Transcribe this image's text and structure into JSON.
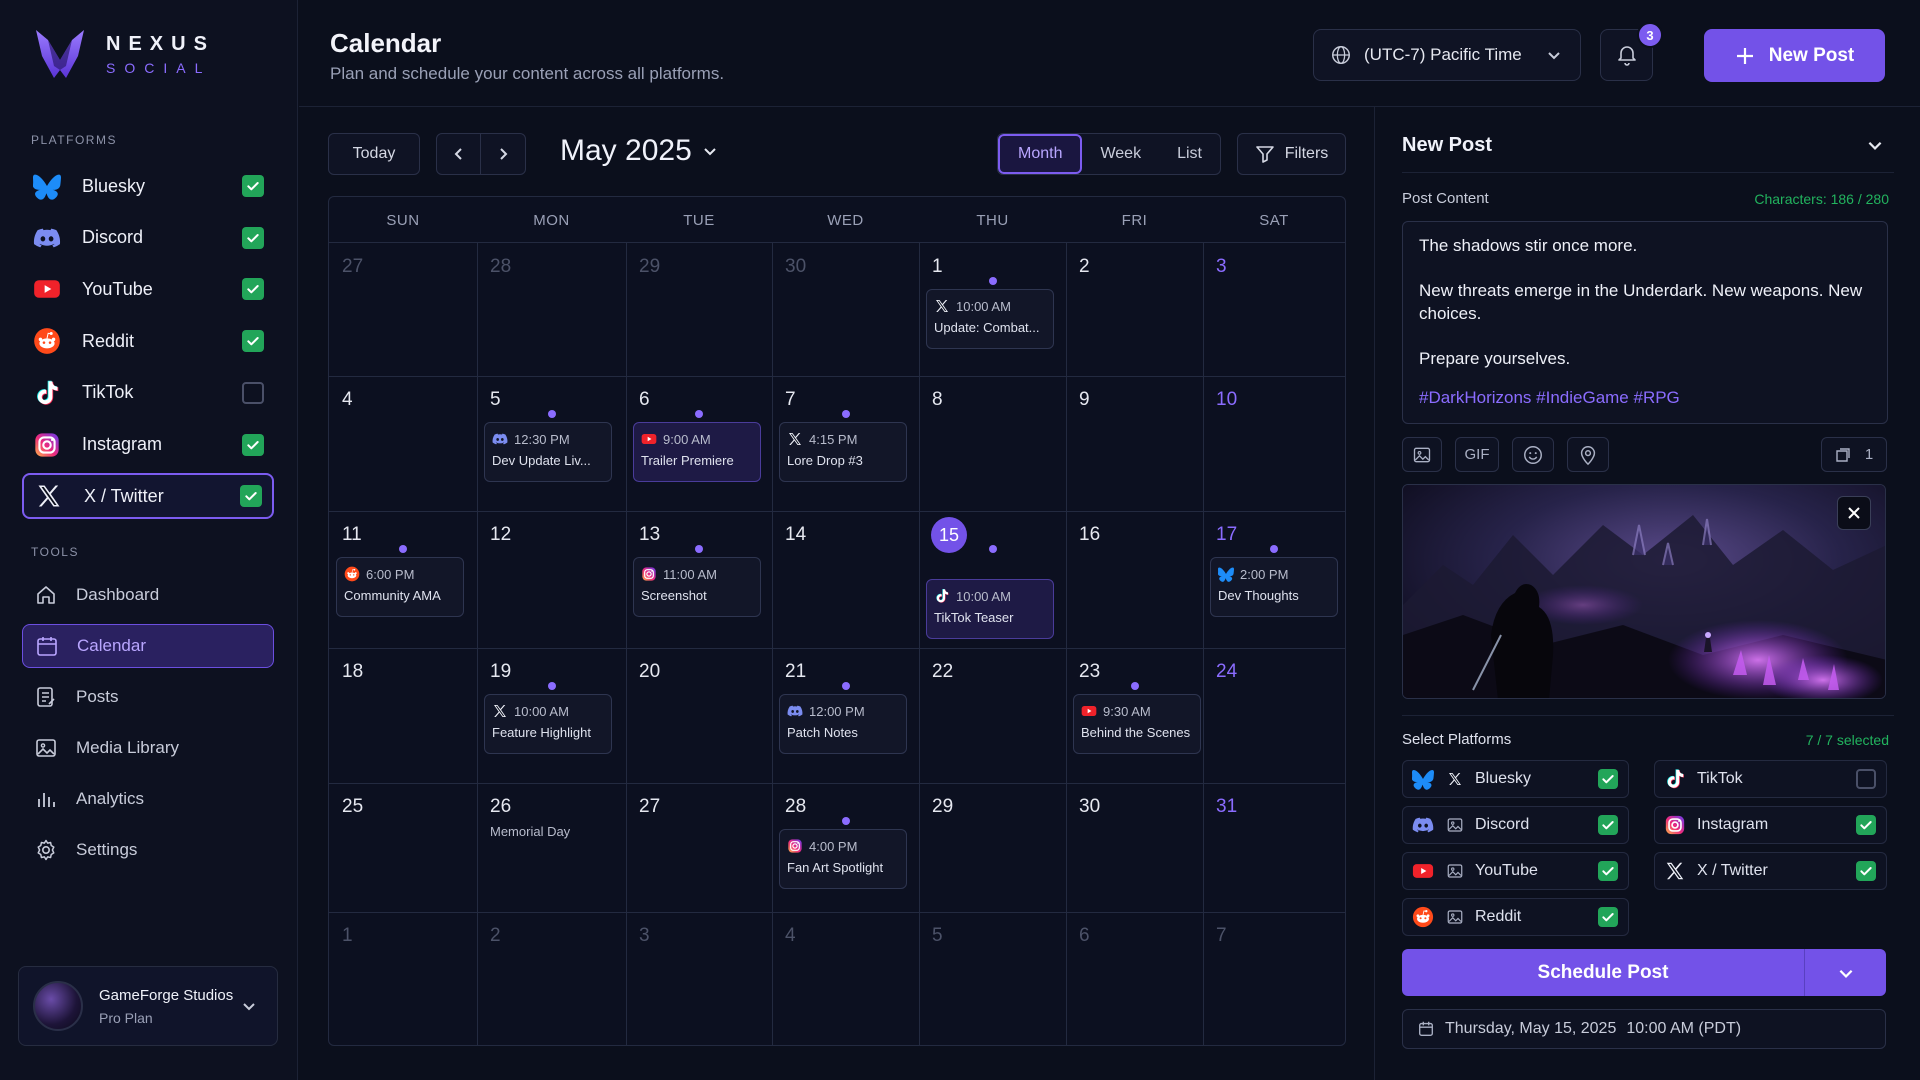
{
  "brand": {
    "name": "NEXUS",
    "tagline": "SOCIAL"
  },
  "sidebar": {
    "platforms_label": "PLATFORMS",
    "platforms": [
      {
        "label": "Bluesky",
        "icon": "bluesky-icon",
        "checked": true
      },
      {
        "label": "Discord",
        "icon": "discord-icon",
        "checked": true
      },
      {
        "label": "YouTube",
        "icon": "youtube-icon",
        "checked": true
      },
      {
        "label": "Reddit",
        "icon": "reddit-icon",
        "checked": true
      },
      {
        "label": "TikTok",
        "icon": "tiktok-icon",
        "checked": false
      },
      {
        "label": "Instagram",
        "icon": "instagram-icon",
        "checked": true
      },
      {
        "label": "X / Twitter",
        "icon": "x-icon",
        "checked": true,
        "active": true
      }
    ],
    "tools_label": "TOOLS",
    "tools": [
      {
        "label": "Dashboard",
        "icon": "home-icon"
      },
      {
        "label": "Calendar",
        "icon": "calendar-icon",
        "active": true
      },
      {
        "label": "Posts",
        "icon": "posts-icon"
      },
      {
        "label": "Media Library",
        "icon": "image-icon"
      },
      {
        "label": "Analytics",
        "icon": "chart-icon"
      },
      {
        "label": "Settings",
        "icon": "gear-icon"
      }
    ],
    "user": {
      "name": "GameForge Studios",
      "plan": "Pro Plan"
    }
  },
  "header": {
    "title": "Calendar",
    "subtitle": "Plan and schedule your content across all platforms.",
    "timezone": "(UTC-7) Pacific Time",
    "notifications": "3",
    "new_post": "New Post"
  },
  "toolbar": {
    "today": "Today",
    "month_label": "May 2025",
    "views": [
      "Month",
      "Week",
      "List"
    ],
    "active_view": "Month",
    "filters": "Filters"
  },
  "calendar": {
    "weekdays": [
      "SUN",
      "MON",
      "TUE",
      "WED",
      "THU",
      "FRI",
      "SAT"
    ],
    "weeks": [
      [
        "27",
        "28",
        "29",
        "30",
        "1",
        "2",
        "3"
      ],
      [
        "4",
        "5",
        "6",
        "7",
        "8",
        "9",
        "10"
      ],
      [
        "11",
        "12",
        "13",
        "14",
        "15",
        "16",
        "17"
      ],
      [
        "18",
        "19",
        "20",
        "21",
        "22",
        "23",
        "24"
      ],
      [
        "25",
        "26",
        "27",
        "28",
        "29",
        "30",
        "31"
      ],
      [
        "1",
        "2",
        "3",
        "4",
        "5",
        "6",
        "7"
      ]
    ],
    "today": "15",
    "holiday": {
      "label": "Memorial Day"
    },
    "events": [
      {
        "time": "10:00 AM",
        "name": "Update: Combat...",
        "platform": "x"
      },
      {
        "time": "12:30 PM",
        "name": "Dev Update Liv...",
        "platform": "discord"
      },
      {
        "time": "9:00 AM",
        "name": "Trailer Premiere",
        "platform": "youtube"
      },
      {
        "time": "4:15 PM",
        "name": "Lore Drop #3",
        "platform": "x"
      },
      {
        "time": "6:00 PM",
        "name": "Community AMA",
        "platform": "reddit"
      },
      {
        "time": "11:00 AM",
        "name": "Screenshot",
        "platform": "instagram"
      },
      {
        "time": "10:00 AM",
        "name": "TikTok Teaser",
        "platform": "tiktok"
      },
      {
        "time": "2:00 PM",
        "name": "Dev Thoughts",
        "platform": "bluesky"
      },
      {
        "time": "10:00 AM",
        "name": "Feature Highlight",
        "platform": "x"
      },
      {
        "time": "12:00 PM",
        "name": "Patch Notes",
        "platform": "discord"
      },
      {
        "time": "9:30 AM",
        "name": "Behind the Scenes",
        "platform": "youtube"
      },
      {
        "time": "4:00 PM",
        "name": "Fan Art Spotlight",
        "platform": "instagram"
      }
    ]
  },
  "panel": {
    "title": "New Post",
    "content_label": "Post Content",
    "char_count": "Characters: 186 / 280",
    "content": {
      "line1": "The shadows stir once more.",
      "line2": "New threats emerge in the Underdark. New weapons. New choices.",
      "line3": "Prepare yourselves.",
      "tags": "#DarkHorizons #IndieGame #RPG"
    },
    "gif_label": "GIF",
    "media_count": "1",
    "platforms_label": "Select Platforms",
    "platforms_count": "7 / 7 selected",
    "platforms": [
      {
        "label": "Bluesky",
        "icon": "bluesky-icon",
        "checked": true
      },
      {
        "label": "TikTok",
        "icon": "tiktok-icon",
        "checked": false
      },
      {
        "label": "Discord",
        "icon": "discord-icon",
        "checked": true
      },
      {
        "label": "Instagram",
        "icon": "instagram-icon",
        "checked": true
      },
      {
        "label": "YouTube",
        "icon": "youtube-icon",
        "checked": true
      },
      {
        "label": "X / Twitter",
        "icon": "x-icon",
        "checked": true
      },
      {
        "label": "Reddit",
        "icon": "reddit-icon",
        "checked": true
      }
    ],
    "schedule_label": "Schedule Post",
    "schedule_date": "Thursday, May 15, 2025",
    "schedule_time": "10:00 AM (PDT)"
  },
  "colors": {
    "accent": "#7352e8",
    "check": "#22a559",
    "bg": "#0b0f1c"
  }
}
